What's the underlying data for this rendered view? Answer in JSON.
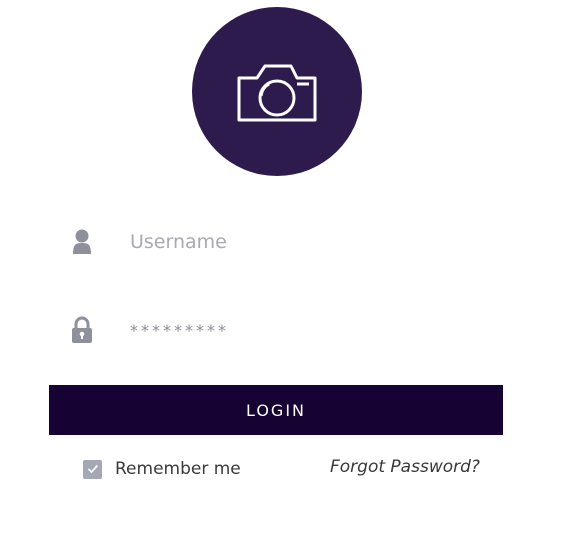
{
  "avatar": {
    "icon": "camera-icon",
    "background_color": "#2e1b4e"
  },
  "form": {
    "username": {
      "icon": "user-icon",
      "placeholder": "Username",
      "value": ""
    },
    "password": {
      "icon": "lock-icon",
      "placeholder": "*********",
      "value": ""
    },
    "login_button": {
      "label": "LOGIN",
      "background_color": "#160333"
    },
    "remember_me": {
      "label": "Remember me",
      "checked": true
    },
    "forgot_password": {
      "label": "Forgot Password?"
    }
  }
}
